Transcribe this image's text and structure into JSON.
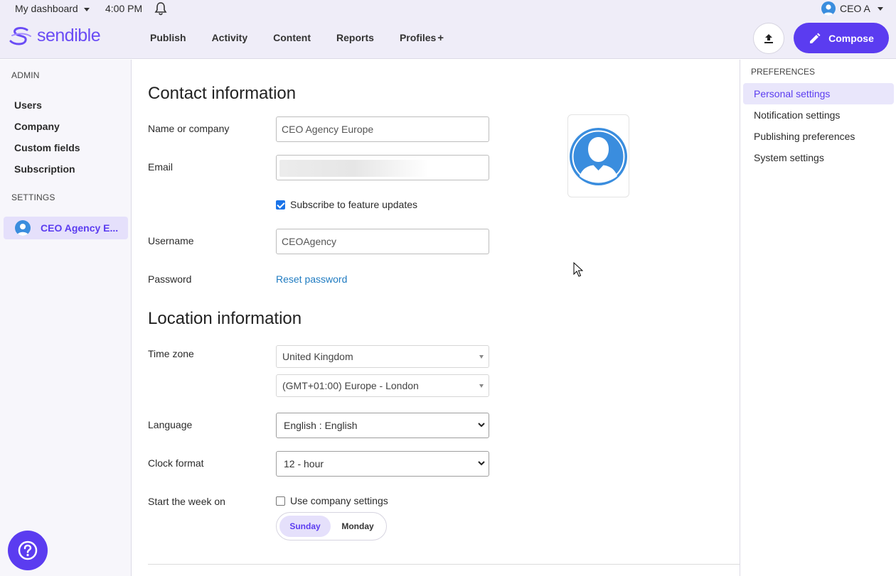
{
  "topbar": {
    "dashboard_label": "My dashboard",
    "time": "4:00 PM",
    "user_name": "CEO A",
    "logo_text": "sendible",
    "nav": [
      "Publish",
      "Activity",
      "Content",
      "Reports",
      "Profiles"
    ],
    "profiles_plus": "+",
    "compose_label": "Compose"
  },
  "sidebar": {
    "admin_label": "ADMIN",
    "admin_items": [
      "Users",
      "Company",
      "Custom fields",
      "Subscription"
    ],
    "settings_label": "SETTINGS",
    "active_item": "CEO Agency E..."
  },
  "main": {
    "contact_heading": "Contact information",
    "name_label": "Name or company",
    "name_value": "CEO Agency Europe",
    "email_label": "Email",
    "subscribe_label": "Subscribe to feature updates",
    "username_label": "Username",
    "username_value": "CEOAgency",
    "password_label": "Password",
    "reset_password": "Reset password",
    "location_heading": "Location information",
    "timezone_label": "Time zone",
    "timezone_country": "United Kingdom",
    "timezone_zone": "(GMT+01:00) Europe - London",
    "language_label": "Language",
    "language_value": "English : English",
    "clock_label": "Clock format",
    "clock_value": "12 - hour",
    "week_label": "Start the week on",
    "company_settings_label": "Use company settings",
    "week_options": [
      "Sunday",
      "Monday"
    ]
  },
  "right": {
    "pref_label": "PREFERENCES",
    "items": [
      "Personal settings",
      "Notification settings",
      "Publishing preferences",
      "System settings"
    ]
  },
  "colors": {
    "accent": "#5b3cf0",
    "link": "#1f7bc1",
    "avatar": "#3a8dde"
  }
}
